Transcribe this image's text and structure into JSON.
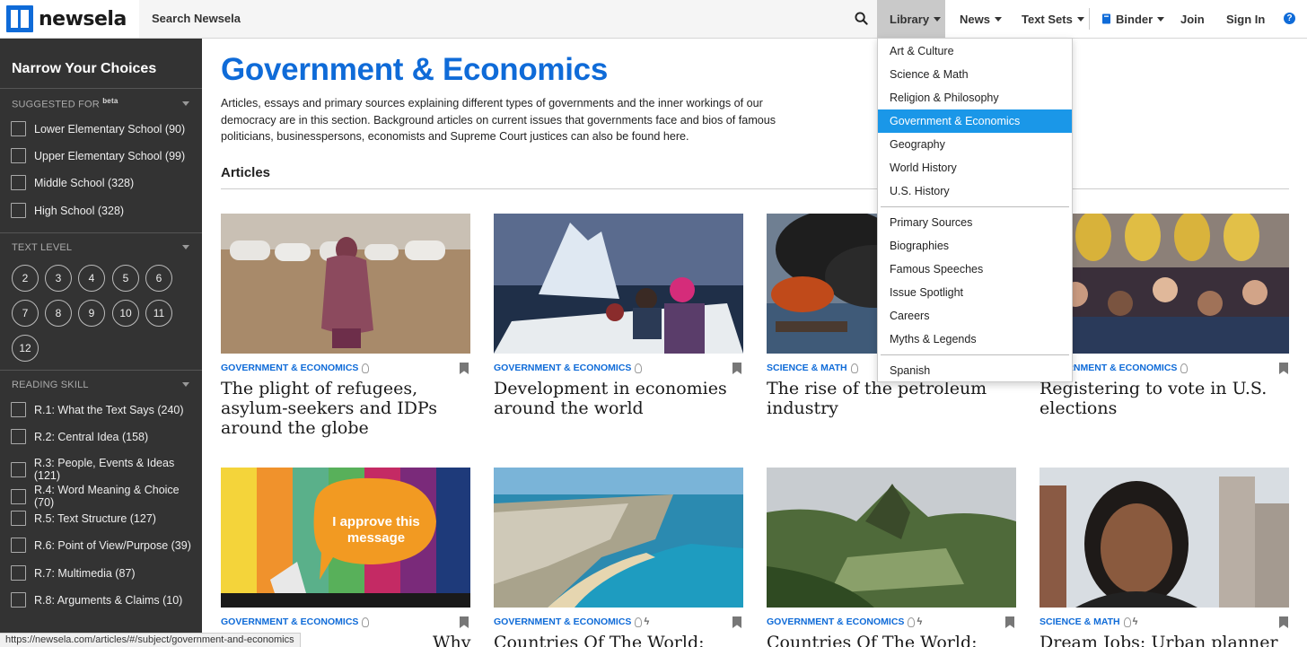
{
  "header": {
    "logo_text": "newsela",
    "search_label": "Search Newsela",
    "nav": {
      "library": "Library",
      "news": "News",
      "text_sets": "Text Sets",
      "binder": "Binder",
      "join": "Join",
      "sign_in": "Sign In",
      "help": "?"
    }
  },
  "sidebar": {
    "title": "Narrow Your Choices",
    "suggested_for": {
      "heading": "SUGGESTED FOR",
      "badge": "beta",
      "options": [
        "Lower Elementary School (90)",
        "Upper Elementary School (99)",
        "Middle School (328)",
        "High School (328)"
      ]
    },
    "text_level": {
      "heading": "TEXT LEVEL",
      "levels": [
        "2",
        "3",
        "4",
        "5",
        "6",
        "7",
        "8",
        "9",
        "10",
        "11",
        "12"
      ]
    },
    "reading_skill": {
      "heading": "READING SKILL",
      "options": [
        "R.1: What the Text Says (240)",
        "R.2: Central Idea (158)",
        "R.3: People, Events & Ideas (121)",
        "R.4: Word Meaning & Choice (70)",
        "R.5: Text Structure (127)",
        "R.6: Point of View/Purpose (39)",
        "R.7: Multimedia (87)",
        "R.8: Arguments & Claims (10)"
      ]
    }
  },
  "main": {
    "title": "Government & Economics",
    "description": "Articles, essays and primary sources explaining different types of governments and the inner workings of our democracy are in this section. Background articles on current issues that governments face and bios of famous politicians, businesspersons, economists and Supreme Court justices can also be found here.",
    "section_heading": "Articles",
    "cards": [
      {
        "category": "GOVERNMENT & ECONOMICS",
        "title": "The plight of refugees, asylum-seekers and IDPs around the globe",
        "bolt": false
      },
      {
        "category": "GOVERNMENT & ECONOMICS",
        "title": "Development in economies around the world",
        "bolt": false
      },
      {
        "category": "SCIENCE & MATH",
        "title": "The rise of the petroleum industry",
        "bolt": false
      },
      {
        "category": "GOVERNMENT & ECONOMICS",
        "title": "Registering to vote in U.S. elections",
        "bolt": false
      },
      {
        "category": "GOVERNMENT & ECONOMICS",
        "title": "Why",
        "bolt": false,
        "image_text": "I approve this message"
      },
      {
        "category": "GOVERNMENT & ECONOMICS",
        "title": "Countries Of The World:",
        "bolt": true
      },
      {
        "category": "GOVERNMENT & ECONOMICS",
        "title": "Countries Of The World: Peru",
        "bolt": true
      },
      {
        "category": "SCIENCE & MATH",
        "title": "Dream Jobs: Urban planner",
        "bolt": true
      }
    ]
  },
  "library_menu": {
    "group1": [
      "Art & Culture",
      "Science & Math",
      "Religion & Philosophy",
      "Government & Economics",
      "Geography",
      "World History",
      "U.S. History"
    ],
    "group2": [
      "Primary Sources",
      "Biographies",
      "Famous Speeches",
      "Issue Spotlight",
      "Careers",
      "Myths & Legends"
    ],
    "group3": [
      "Spanish"
    ],
    "selected": "Government & Economics"
  },
  "status_bar": {
    "url": "https://newsela.com/articles/#/subject/government-and-economics"
  },
  "colors": {
    "brand_blue": "#0f6bd8",
    "sidebar_bg": "#333333",
    "menu_highlight": "#1a97e8"
  }
}
